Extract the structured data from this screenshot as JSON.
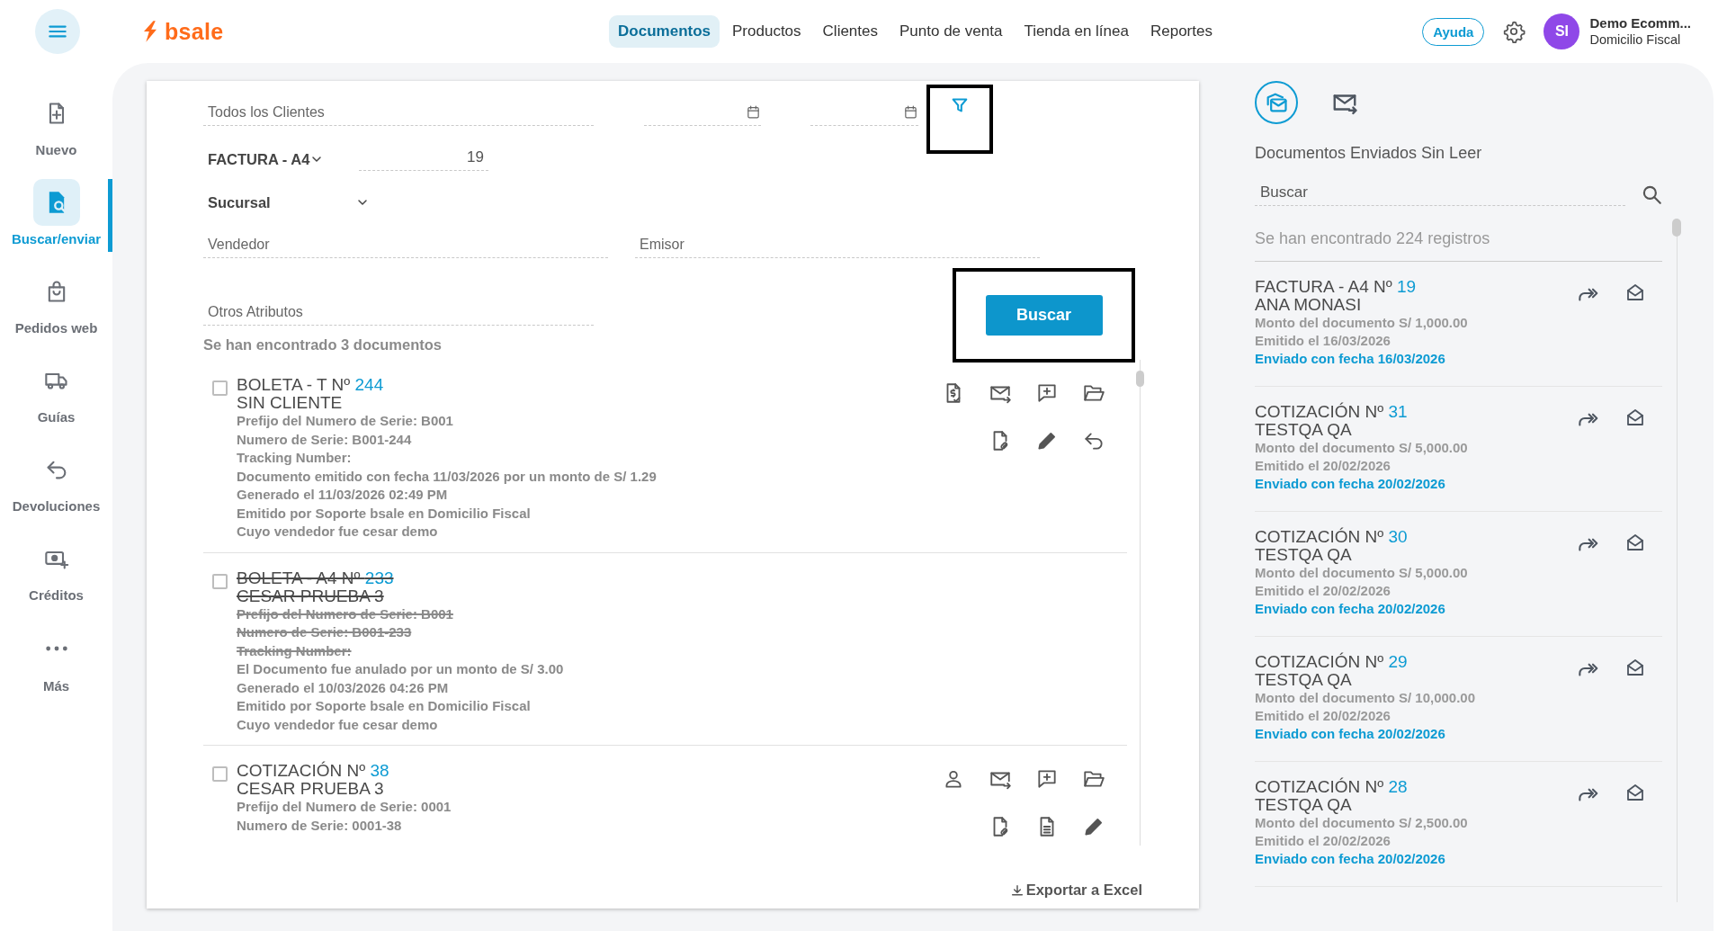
{
  "topbar": {
    "logo": "bsale",
    "nav": [
      {
        "label": "Documentos",
        "selected": true
      },
      {
        "label": "Productos",
        "selected": false
      },
      {
        "label": "Clientes",
        "selected": false
      },
      {
        "label": "Punto de venta",
        "selected": false
      },
      {
        "label": "Tienda en línea",
        "selected": false
      },
      {
        "label": "Reportes",
        "selected": false
      }
    ],
    "help": "Ayuda",
    "user": {
      "initials": "SI",
      "name": "Demo Ecomm...",
      "location": "Domicilio Fiscal"
    }
  },
  "sidebar": {
    "items": [
      {
        "kind": "new",
        "label": "Nuevo",
        "selected": false
      },
      {
        "kind": "search",
        "label": "Buscar/enviar",
        "selected": true
      },
      {
        "kind": "orders",
        "label": "Pedidos web",
        "selected": false
      },
      {
        "kind": "shipping",
        "label": "Guías",
        "selected": false
      },
      {
        "kind": "returns",
        "label": "Devoluciones",
        "selected": false
      },
      {
        "kind": "credits",
        "label": "Créditos",
        "selected": false
      },
      {
        "kind": "more",
        "label": "Más",
        "selected": false
      }
    ]
  },
  "filters": {
    "client": {
      "placeholder": "Todos los Clientes"
    },
    "filter_button": {
      "highlighted": true
    },
    "document_type": {
      "value": "FACTURA - A4"
    },
    "number": {
      "value": "19"
    },
    "branch": {
      "value": "Sucursal"
    },
    "seller": {
      "placeholder": "Vendedor"
    },
    "issuer": {
      "placeholder": "Emisor"
    },
    "other_attributes": {
      "placeholder": "Otros Atributos"
    },
    "search_button": {
      "label": "Buscar",
      "highlighted": true
    }
  },
  "results": {
    "count": "Se han encontrado 3 documentos",
    "documents": [
      {
        "type": "BOLETA - T Nº",
        "number": "244",
        "client": "SIN CLIENTE",
        "checked": false,
        "voided": false,
        "lines": [
          {
            "text": "Prefijo del Numero de Serie: B001",
            "struck": false
          },
          {
            "text": "Numero de Serie: B001-244",
            "struck": false
          },
          {
            "text": "Tracking Number:",
            "struck": false
          },
          {
            "text": "Documento emitido con fecha 11/03/2026 por un monto de S/ 1.29",
            "struck": false
          },
          {
            "text": "Generado el 11/03/2026 02:49 PM",
            "struck": false
          },
          {
            "text": "Emitido por Soporte bsale en Domicilio Fiscal",
            "struck": false
          },
          {
            "text": "Cuyo vendedor fue cesar demo",
            "struck": false
          }
        ],
        "actions": [
          {
            "icons": [
              {
                "kind": "receipt"
              },
              {
                "kind": "mail-send"
              },
              {
                "kind": "comment-add"
              },
              {
                "kind": "folder"
              }
            ]
          },
          {
            "icons": [
              {
                "kind": "file-link"
              },
              {
                "kind": "pencil"
              },
              {
                "kind": "undo"
              }
            ]
          }
        ]
      },
      {
        "type": "BOLETA - A4 Nº",
        "number": "233",
        "client": "CESAR PRUEBA 3",
        "checked": false,
        "voided": true,
        "lines": [
          {
            "text": "Prefijo del Numero de Serie: B001",
            "struck": true
          },
          {
            "text": "Numero de Serie: B001-233",
            "struck": true
          },
          {
            "text": "Tracking Number:",
            "struck": true
          },
          {
            "text": "El Documento fue anulado por un monto de S/ 3.00",
            "struck": false
          },
          {
            "text": "Generado el 10/03/2026 04:26 PM",
            "struck": false
          },
          {
            "text": "Emitido por Soporte bsale en Domicilio Fiscal",
            "struck": false
          },
          {
            "text": "Cuyo vendedor fue cesar demo",
            "struck": false
          }
        ]
      },
      {
        "type": "COTIZACIÓN Nº",
        "number": "38",
        "client": "CESAR PRUEBA 3",
        "checked": false,
        "voided": false,
        "lines": [
          {
            "text": "Prefijo del Numero de Serie: 0001",
            "struck": false
          },
          {
            "text": "Numero de Serie: 0001-38",
            "struck": false
          }
        ],
        "actions": [
          {
            "icons": [
              {
                "kind": "person"
              },
              {
                "kind": "mail-send"
              },
              {
                "kind": "comment-add"
              },
              {
                "kind": "folder"
              }
            ]
          },
          {
            "icons": [
              {
                "kind": "file-link"
              },
              {
                "kind": "document"
              },
              {
                "kind": "pencil"
              }
            ]
          }
        ]
      }
    ],
    "export": "Exportar a Excel"
  },
  "panel": {
    "tabs": [
      {
        "kind": "unread",
        "selected": true
      },
      {
        "kind": "sent",
        "selected": false
      }
    ],
    "title": "Documentos Enviados Sin Leer",
    "search": {
      "placeholder": "Buscar"
    },
    "count": "Se han encontrado 224 registros",
    "items": [
      {
        "type": "FACTURA - A4 Nº",
        "number": "19",
        "client": "ANA MONASI",
        "amount": "Monto del documento S/ 1,000.00",
        "issued": "Emitido el 16/03/2026",
        "sent": "Enviado con fecha 16/03/2026"
      },
      {
        "type": "COTIZACIÓN Nº",
        "number": "31",
        "client": "TESTQA QA",
        "amount": "Monto del documento S/ 5,000.00",
        "issued": "Emitido el 20/02/2026",
        "sent": "Enviado con fecha 20/02/2026"
      },
      {
        "type": "COTIZACIÓN Nº",
        "number": "30",
        "client": "TESTQA QA",
        "amount": "Monto del documento S/ 5,000.00",
        "issued": "Emitido el 20/02/2026",
        "sent": "Enviado con fecha 20/02/2026"
      },
      {
        "type": "COTIZACIÓN Nº",
        "number": "29",
        "client": "TESTQA QA",
        "amount": "Monto del documento S/ 10,000.00",
        "issued": "Emitido el 20/02/2026",
        "sent": "Enviado con fecha 20/02/2026"
      },
      {
        "type": "COTIZACIÓN Nº",
        "number": "28",
        "client": "TESTQA QA",
        "amount": "Monto del documento S/ 2,500.00",
        "issued": "Emitido el 20/02/2026",
        "sent": "Enviado con fecha 20/02/2026"
      }
    ]
  }
}
